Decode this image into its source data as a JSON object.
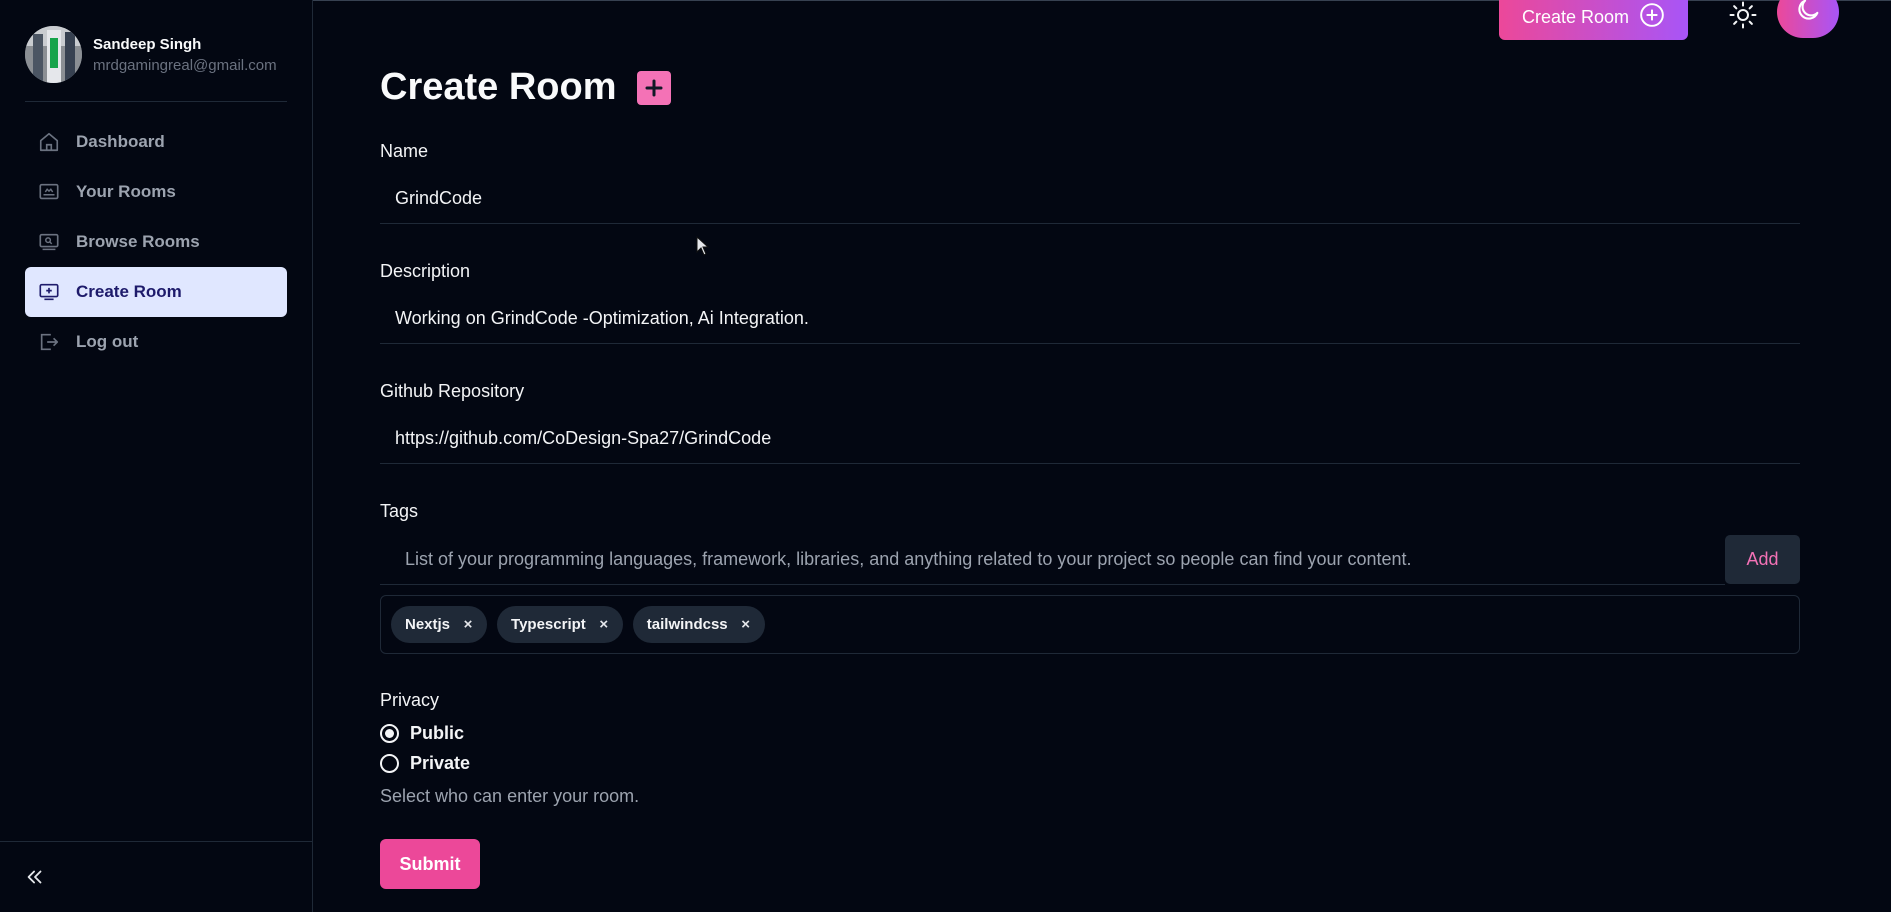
{
  "user": {
    "name": "Sandeep Singh",
    "email": "mrdgamingreal@gmail.com"
  },
  "sidebar": {
    "items": [
      {
        "label": "Dashboard",
        "icon": "home-icon"
      },
      {
        "label": "Your Rooms",
        "icon": "rooms-icon"
      },
      {
        "label": "Browse Rooms",
        "icon": "browse-icon"
      },
      {
        "label": "Create Room",
        "icon": "create-room-icon",
        "active": true
      },
      {
        "label": "Log out",
        "icon": "logout-icon"
      }
    ]
  },
  "header": {
    "create_room_label": "Create Room"
  },
  "page": {
    "title": "Create Room"
  },
  "form": {
    "name": {
      "label": "Name",
      "value": "GrindCode"
    },
    "description": {
      "label": "Description",
      "value": "Working on GrindCode -Optimization, Ai Integration."
    },
    "github": {
      "label": "Github Repository",
      "value": "https://github.com/CoDesign-Spa27/GrindCode"
    },
    "tags": {
      "label": "Tags",
      "placeholder": "List of your programming languages, framework, libraries, and anything related to your project so people can find your content.",
      "add_label": "Add",
      "items": [
        "Nextjs",
        "Typescript",
        "tailwindcss"
      ],
      "remove_glyph": "×"
    },
    "privacy": {
      "label": "Privacy",
      "options": [
        {
          "label": "Public",
          "selected": true
        },
        {
          "label": "Private",
          "selected": false
        }
      ],
      "help": "Select who can enter your room."
    },
    "submit_label": "Submit"
  },
  "colors": {
    "background": "#030712",
    "accent_pink": "#ec4899",
    "accent_purple": "#a855f7",
    "active_nav_bg": "#e0e7ff"
  }
}
